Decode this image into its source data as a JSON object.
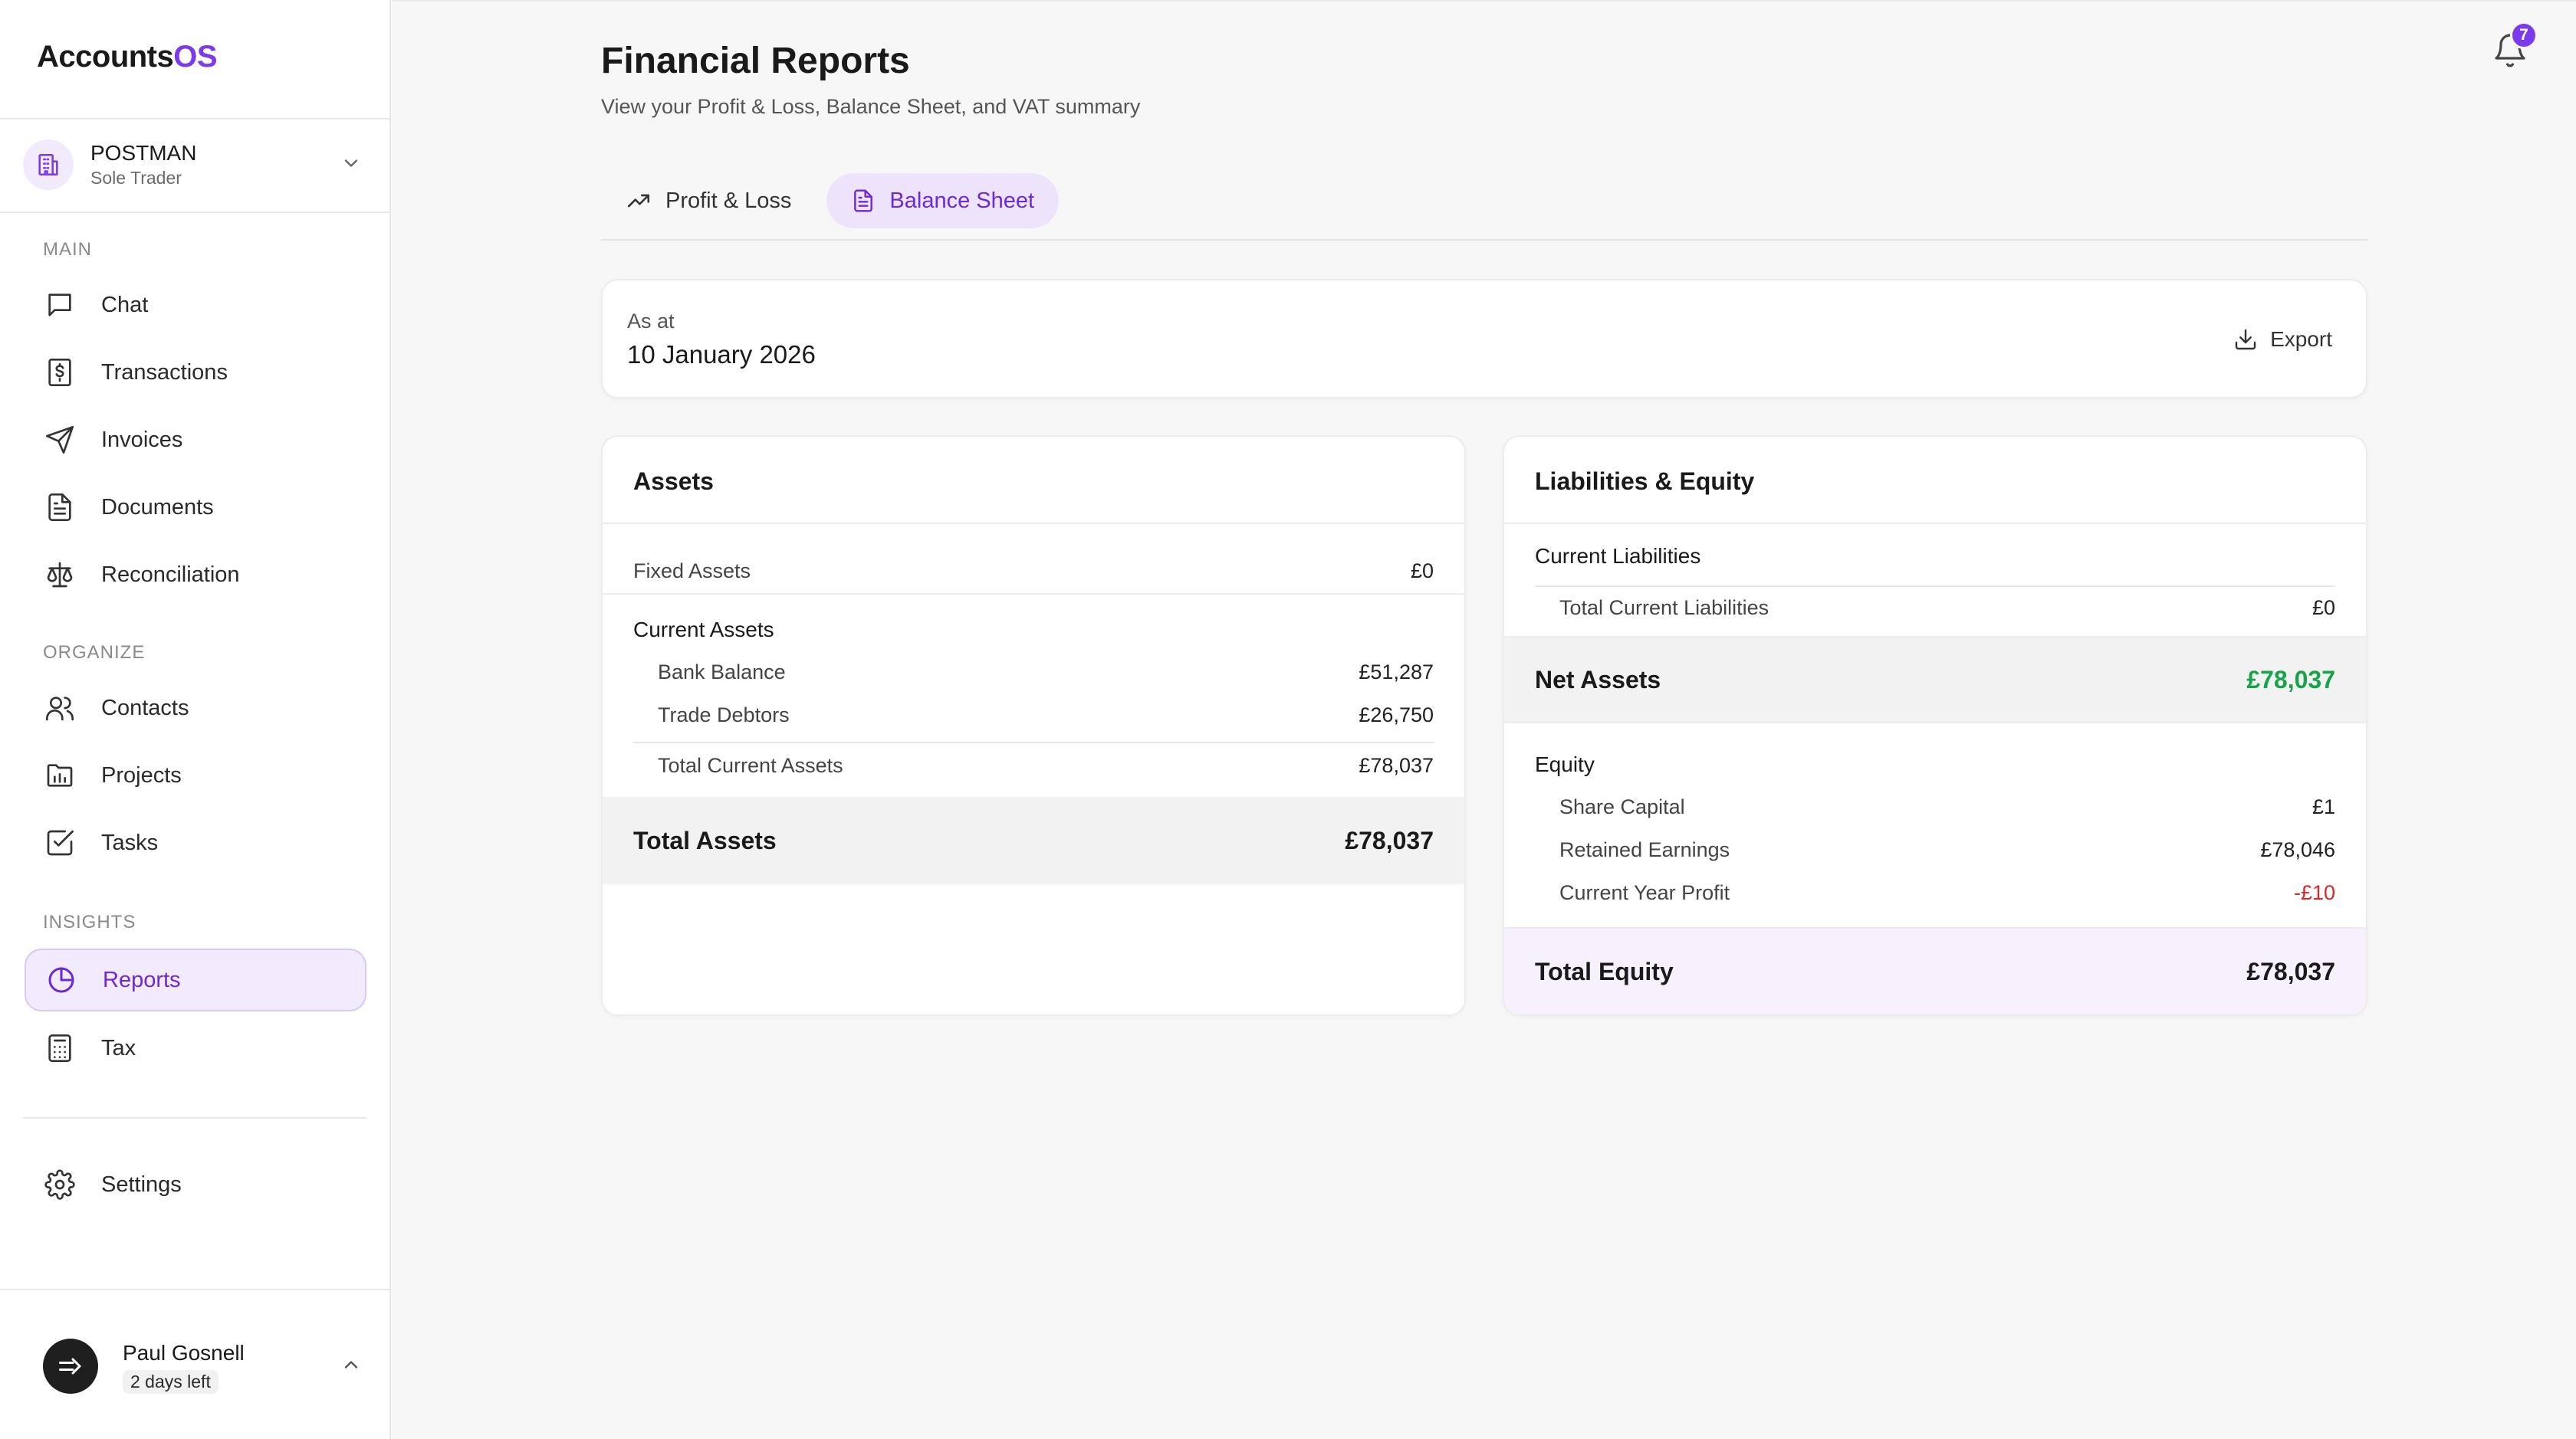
{
  "app": {
    "logo_main": "Accounts",
    "logo_accent": "OS",
    "accent_color": "#7c3aed"
  },
  "org": {
    "name": "POSTMAN",
    "type": "Sole Trader"
  },
  "sidebar": {
    "sections": {
      "main": "MAIN",
      "organize": "ORGANIZE",
      "insights": "INSIGHTS"
    },
    "items": {
      "chat": "Chat",
      "transactions": "Transactions",
      "invoices": "Invoices",
      "documents": "Documents",
      "reconciliation": "Reconciliation",
      "contacts": "Contacts",
      "projects": "Projects",
      "tasks": "Tasks",
      "reports": "Reports",
      "tax": "Tax",
      "settings": "Settings"
    },
    "active": "reports"
  },
  "user": {
    "name": "Paul Gosnell",
    "trial": "2 days left"
  },
  "notifications": {
    "count": "7"
  },
  "header": {
    "title": "Financial Reports",
    "subtitle": "View your Profit & Loss, Balance Sheet, and VAT summary"
  },
  "tabs": [
    {
      "label": "Profit & Loss",
      "icon": "trending-up-icon",
      "active": false
    },
    {
      "label": "Balance Sheet",
      "icon": "document-icon",
      "active": true
    }
  ],
  "as_at": {
    "label": "As at",
    "date": "10 January 2026",
    "export_label": "Export"
  },
  "assets": {
    "title": "Assets",
    "fixed_label": "Fixed Assets",
    "fixed_value": "£0",
    "current_title": "Current Assets",
    "bank_label": "Bank Balance",
    "bank_value": "£51,287",
    "debtors_label": "Trade Debtors",
    "debtors_value": "£26,750",
    "total_current_label": "Total Current Assets",
    "total_current_value": "£78,037",
    "total_label": "Total Assets",
    "total_value": "£78,037"
  },
  "liabilities": {
    "title": "Liabilities & Equity",
    "current_title": "Current Liabilities",
    "total_current_label": "Total Current Liabilities",
    "total_current_value": "£0",
    "net_assets_label": "Net Assets",
    "net_assets_value": "£78,037",
    "equity_title": "Equity",
    "share_capital_label": "Share Capital",
    "share_capital_value": "£1",
    "retained_label": "Retained Earnings",
    "retained_value": "£78,046",
    "cyp_label": "Current Year Profit",
    "cyp_value": "-£10",
    "total_equity_label": "Total Equity",
    "total_equity_value": "£78,037"
  },
  "colors": {
    "positive": "#16a34a",
    "negative": "#dc2626",
    "active_bg": "#f1ebfd"
  }
}
